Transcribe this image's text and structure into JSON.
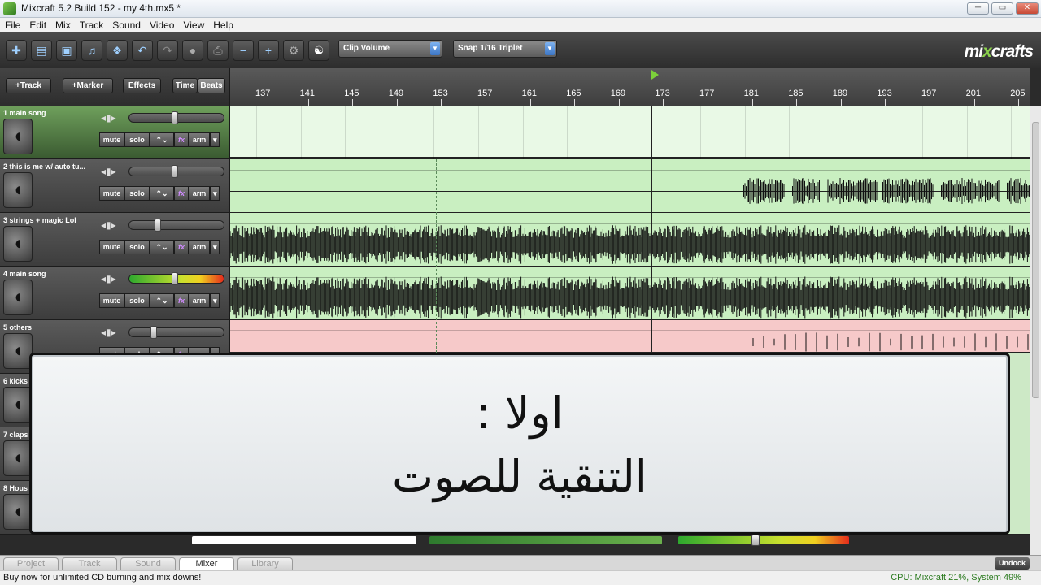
{
  "window": {
    "title": "Mixcraft 5.2 Build 152 - my 4th.mx5 *"
  },
  "menu": [
    "File",
    "Edit",
    "Mix",
    "Track",
    "Sound",
    "Video",
    "View",
    "Help"
  ],
  "toolbar": {
    "dropdown_clip_volume": "Clip Volume",
    "dropdown_snap": "Snap 1/16 Triplet",
    "logo": "mixcraft",
    "logo_x": "x",
    "logo_tail": "craft5"
  },
  "controls": {
    "add_track": "+Track",
    "add_marker": "+Marker",
    "effects": "Effects",
    "time": "Time",
    "beats": "Beats"
  },
  "ruler": {
    "labels": [
      "137",
      "141",
      "145",
      "149",
      "153",
      "157",
      "161",
      "165",
      "169",
      "173",
      "177",
      "181",
      "185",
      "189",
      "193",
      "197",
      "201",
      "205"
    ]
  },
  "tracks": [
    {
      "name": "1 main song",
      "volume": 0.5
    },
    {
      "name": "2 this is me w/ auto tu...",
      "volume": 0.5
    },
    {
      "name": "3 strings + magic Lol",
      "volume": 0.3
    },
    {
      "name": "4 main song",
      "volume": 0.5
    },
    {
      "name": "5 others",
      "volume": 0.25
    },
    {
      "name": "6 kicks"
    },
    {
      "name": "7 claps"
    },
    {
      "name": "8 Hous"
    }
  ],
  "track_buttons": {
    "mute": "mute",
    "solo": "solo",
    "fx": "fx",
    "arm": "arm"
  },
  "overlay": {
    "line1": "اولا :",
    "line2": "التنقية للصوت"
  },
  "bottom_tabs": [
    "Project",
    "Track",
    "Sound",
    "Mixer",
    "Library"
  ],
  "active_tab": "Mixer",
  "undock": "Undock",
  "status": {
    "message": "Buy now for unlimited CD burning and mix downs!",
    "cpu": "CPU: Mixcraft 21%, System 49%"
  },
  "colors": {
    "accent_green": "#7cd13a",
    "lane_green": "#c9efc1",
    "lane_red": "#f6c9c9"
  }
}
